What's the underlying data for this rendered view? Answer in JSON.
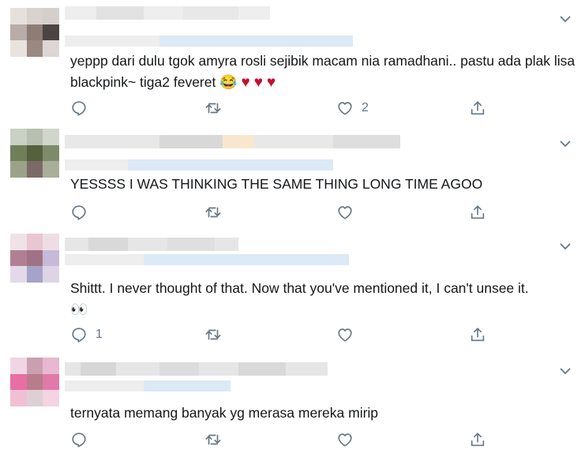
{
  "replies": [
    {
      "text": "yeppp dari dulu tgok amyra rosli sejibik macam nia ramadhani.. pastu ada plak lisa blackpink~ tiga2 feveret",
      "emoji": "😂",
      "hearts": [
        "♥",
        "♥",
        "♥"
      ],
      "reply_count": "",
      "retweet_count": "",
      "like_count": "2"
    },
    {
      "text": "YESSSS I WAS THINKING THE SAME THING LONG TIME AGOO",
      "reply_count": "",
      "retweet_count": "",
      "like_count": ""
    },
    {
      "text": "Shittt. I never thought of that. Now that you've mentioned it, I can't unsee it.",
      "emoji": "👀",
      "reply_count": "1",
      "retweet_count": "",
      "like_count": ""
    },
    {
      "text": "ternyata memang banyak yg merasa mereka mirip",
      "reply_count": "",
      "retweet_count": "",
      "like_count": ""
    }
  ],
  "icons": {
    "reply": "reply-icon",
    "retweet": "retweet-icon",
    "like": "like-icon",
    "share": "share-icon",
    "more": "chevron-down-icon"
  },
  "colors": {
    "icon": "#657786",
    "heart": "#c40f2f",
    "blur_blue": "#dce9f6",
    "blur_gray": "#e6e6e6"
  }
}
